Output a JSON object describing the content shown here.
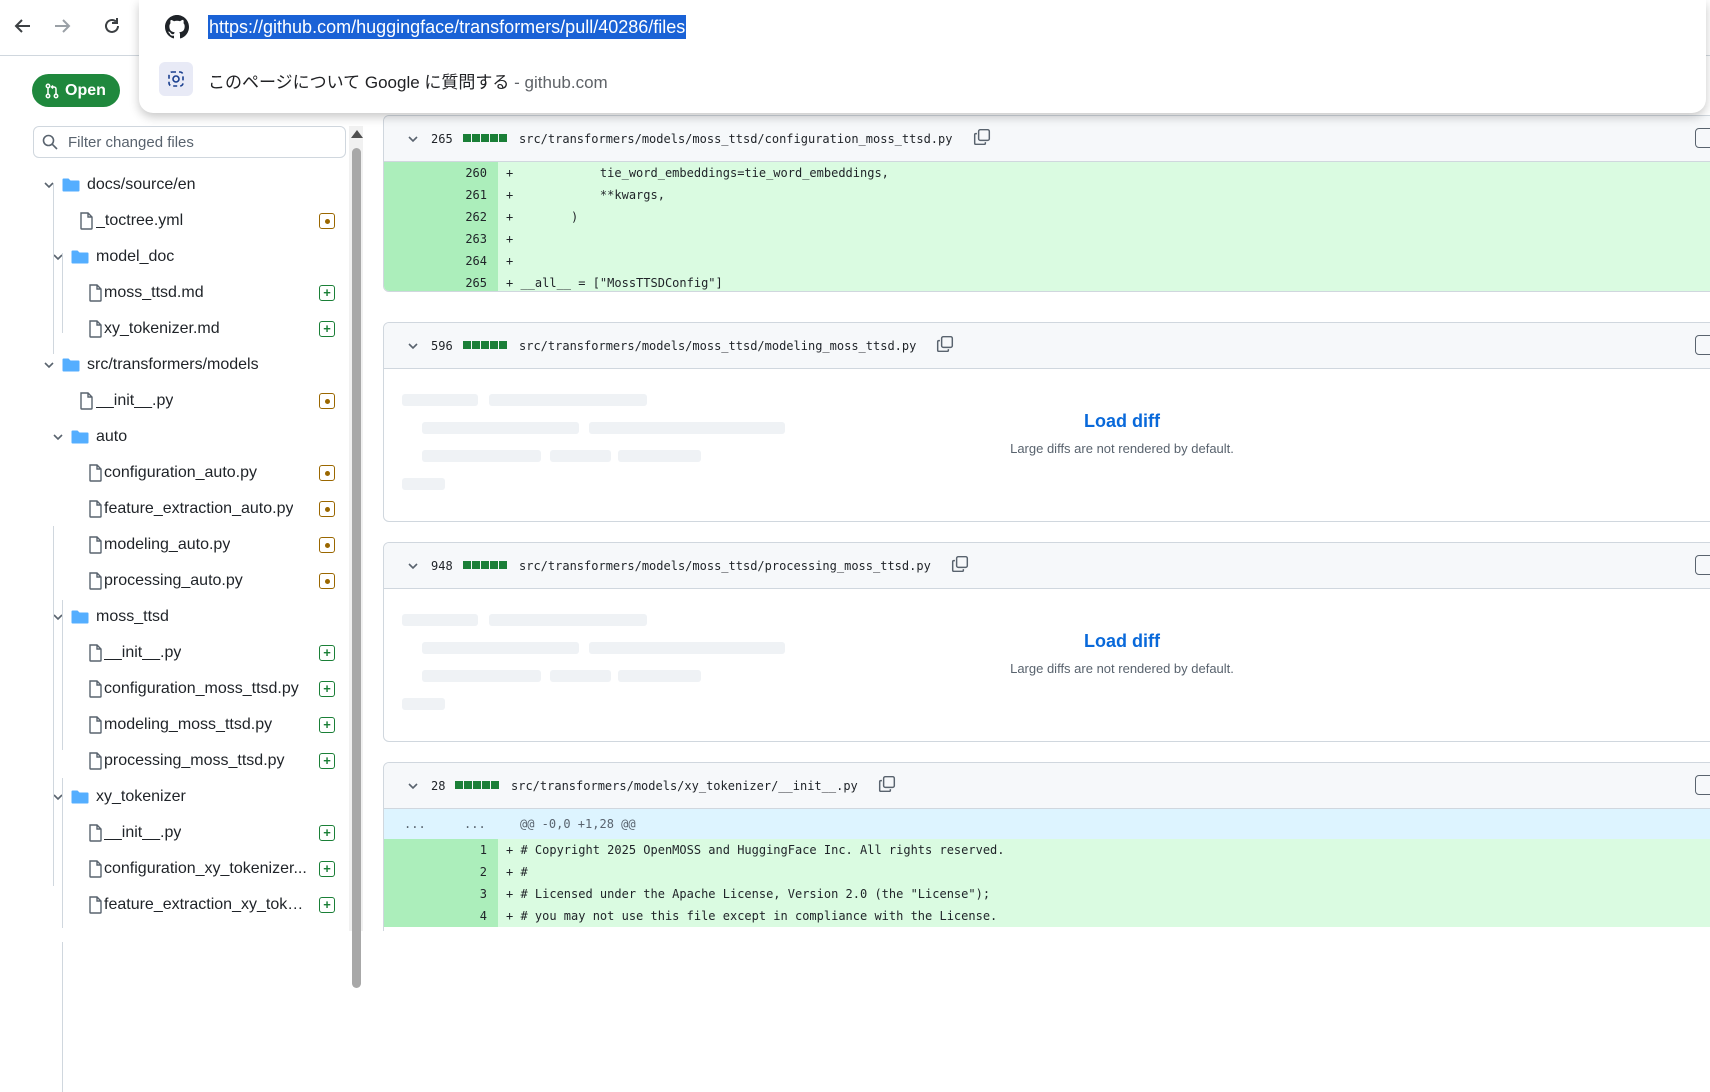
{
  "browser": {
    "url": "https://github.com/huggingface/transformers/pull/40286/files",
    "suggestion": "このページについて Google に質問する",
    "suggestion_sep": " - ",
    "suggestion_domain": "github.com"
  },
  "pr": {
    "state_label": "Open"
  },
  "sidebar": {
    "filter_placeholder": "Filter changed files",
    "tree": [
      {
        "type": "folder",
        "label": "docs/source/en",
        "level": 0
      },
      {
        "type": "file",
        "label": "_toctree.yml",
        "level": 1,
        "status": "modified"
      },
      {
        "type": "folder",
        "label": "model_doc",
        "level": 1
      },
      {
        "type": "file",
        "label": "moss_ttsd.md",
        "level": 2,
        "status": "added"
      },
      {
        "type": "file",
        "label": "xy_tokenizer.md",
        "level": 2,
        "status": "added"
      },
      {
        "type": "folder",
        "label": "src/transformers/models",
        "level": 0
      },
      {
        "type": "file",
        "label": "__init__.py",
        "level": 1,
        "status": "modified"
      },
      {
        "type": "folder",
        "label": "auto",
        "level": 1
      },
      {
        "type": "file",
        "label": "configuration_auto.py",
        "level": 2,
        "status": "modified"
      },
      {
        "type": "file",
        "label": "feature_extraction_auto.py",
        "level": 2,
        "status": "modified"
      },
      {
        "type": "file",
        "label": "modeling_auto.py",
        "level": 2,
        "status": "modified"
      },
      {
        "type": "file",
        "label": "processing_auto.py",
        "level": 2,
        "status": "modified"
      },
      {
        "type": "folder",
        "label": "moss_ttsd",
        "level": 1
      },
      {
        "type": "file",
        "label": "__init__.py",
        "level": 2,
        "status": "added"
      },
      {
        "type": "file",
        "label": "configuration_moss_ttsd.py",
        "level": 2,
        "status": "added"
      },
      {
        "type": "file",
        "label": "modeling_moss_ttsd.py",
        "level": 2,
        "status": "added"
      },
      {
        "type": "file",
        "label": "processing_moss_ttsd.py",
        "level": 2,
        "status": "added"
      },
      {
        "type": "folder",
        "label": "xy_tokenizer",
        "level": 1
      },
      {
        "type": "file",
        "label": "__init__.py",
        "level": 2,
        "status": "added"
      },
      {
        "type": "file",
        "label": "configuration_xy_tokenizer...",
        "level": 2,
        "status": "added"
      },
      {
        "type": "file",
        "label": "feature_extraction_xy_toke...",
        "level": 2,
        "status": "added"
      }
    ]
  },
  "diff_files": [
    {
      "count": "265",
      "path": "src/transformers/models/moss_ttsd/configuration_moss_ttsd.py",
      "lines": [
        {
          "num": "260",
          "code": "+            tie_word_embeddings=tie_word_embeddings,"
        },
        {
          "num": "261",
          "code": "+            **kwargs,"
        },
        {
          "num": "262",
          "code": "+        )"
        },
        {
          "num": "263",
          "code": "+"
        },
        {
          "num": "264",
          "code": "+"
        },
        {
          "num": "265",
          "code": "+ __all__ = [\"MossTTSDConfig\"]"
        }
      ]
    },
    {
      "count": "596",
      "path": "src/transformers/models/moss_ttsd/modeling_moss_ttsd.py",
      "load_label": "Load diff",
      "load_note": "Large diffs are not rendered by default."
    },
    {
      "count": "948",
      "path": "src/transformers/models/moss_ttsd/processing_moss_ttsd.py",
      "load_label": "Load diff",
      "load_note": "Large diffs are not rendered by default."
    },
    {
      "count": "28",
      "path": "src/transformers/models/xy_tokenizer/__init__.py",
      "hunk": {
        "left": "...",
        "right": "...",
        "text": "@@ -0,0 +1,28 @@"
      },
      "lines": [
        {
          "num": "1",
          "code": "+ # Copyright 2025 OpenMOSS and HuggingFace Inc. All rights reserved."
        },
        {
          "num": "2",
          "code": "+ #"
        },
        {
          "num": "3",
          "code": "+ # Licensed under the Apache License, Version 2.0 (the \"License\");"
        },
        {
          "num": "4",
          "code": "+ # you may not use this file except in compliance with the License."
        }
      ]
    }
  ],
  "colors": {
    "addition_line": "#dafbe1",
    "addition_gutter": "#aceebb",
    "hunk": "#ddf4ff",
    "link": "#0969da",
    "open_badge": "#1f883d",
    "url_highlight": "#1a62d6"
  }
}
